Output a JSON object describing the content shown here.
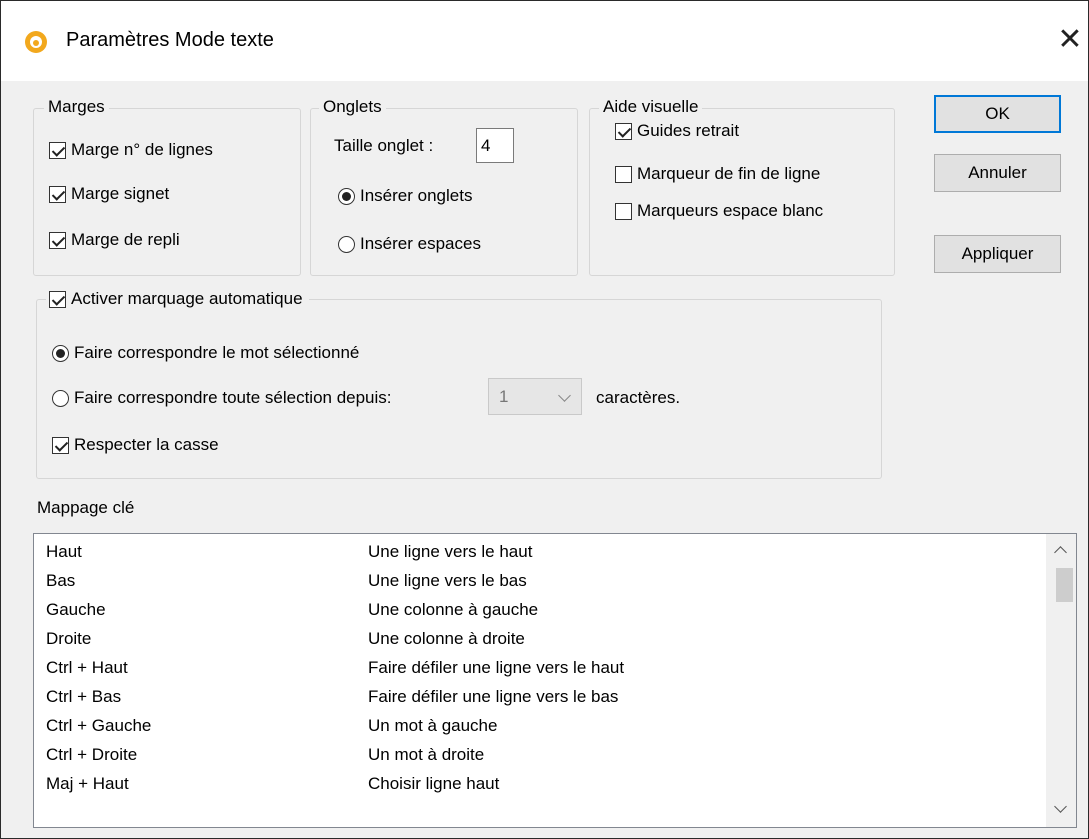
{
  "window": {
    "title": "Paramètres Mode texte",
    "close_glyph": "✕"
  },
  "margins": {
    "legend": "Marges",
    "items": [
      {
        "label": "Marge n° de lignes",
        "checked": true
      },
      {
        "label": "Marge signet",
        "checked": true
      },
      {
        "label": "Marge de repli",
        "checked": true
      }
    ]
  },
  "tabs": {
    "legend": "Onglets",
    "tab_size_label": "Taille onglet :",
    "tab_size_value": "4",
    "options": [
      {
        "label": "Insérer onglets",
        "selected": true
      },
      {
        "label": "Insérer espaces",
        "selected": false
      }
    ]
  },
  "visual_aid": {
    "legend": "Aide visuelle",
    "items": [
      {
        "label": "Guides retrait",
        "checked": true
      },
      {
        "label": "Marqueur de fin de ligne",
        "checked": false
      },
      {
        "label": "Marqueurs espace blanc",
        "checked": false
      }
    ]
  },
  "auto_highlight": {
    "label": "Activer marquage automatique",
    "checked": true,
    "match_word_label": "Faire correspondre le mot sélectionné",
    "match_selection_label": "Faire correspondre toute sélection depuis:",
    "chars_value": "1",
    "chars_suffix": "caractères.",
    "case_label": "Respecter la casse",
    "case_checked": true
  },
  "buttons": {
    "ok": "OK",
    "cancel": "Annuler",
    "apply": "Appliquer"
  },
  "key_mapping": {
    "label": "Mappage clé",
    "rows": [
      {
        "key": "Haut",
        "action": "Une ligne vers le haut"
      },
      {
        "key": "Bas",
        "action": "Une ligne vers le bas"
      },
      {
        "key": "Gauche",
        "action": "Une colonne à gauche"
      },
      {
        "key": "Droite",
        "action": "Une colonne à droite"
      },
      {
        "key": "Ctrl + Haut",
        "action": "Faire défiler une ligne vers le haut"
      },
      {
        "key": "Ctrl + Bas",
        "action": "Faire défiler une ligne vers le bas"
      },
      {
        "key": "Ctrl + Gauche",
        "action": "Un mot à gauche"
      },
      {
        "key": "Ctrl + Droite",
        "action": "Un mot à droite"
      },
      {
        "key": "Maj + Haut",
        "action": "Choisir ligne haut"
      }
    ]
  }
}
